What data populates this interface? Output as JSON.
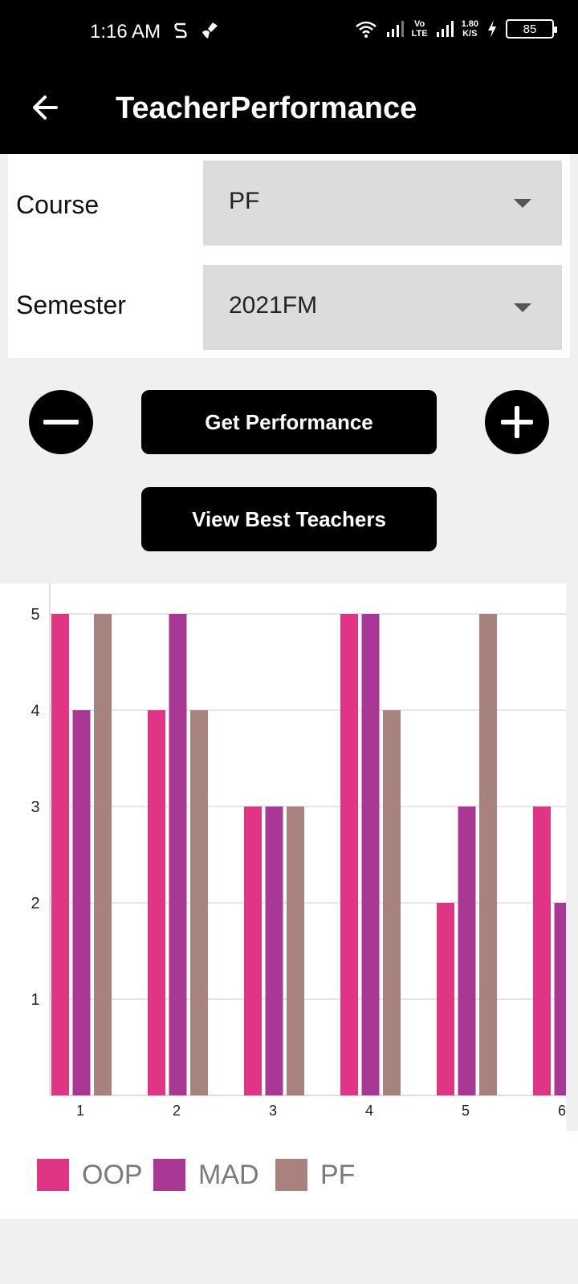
{
  "status_bar": {
    "time": "1:16 AM",
    "net_speed_value": "1.80",
    "net_speed_unit": "K/S",
    "lte_top": "Vo",
    "lte_bottom": "LTE",
    "battery": "85"
  },
  "app_bar": {
    "title": "TeacherPerformance"
  },
  "form": {
    "course_label": "Course",
    "course_value": "PF",
    "semester_label": "Semester",
    "semester_value": "2021FM"
  },
  "buttons": {
    "get_performance": "Get Performance",
    "view_best_teachers": "View Best Teachers"
  },
  "colors": {
    "OOP": "#e03585",
    "MAD": "#a83893",
    "PF": "#a8827c"
  },
  "chart_data": {
    "type": "bar",
    "categories": [
      "1",
      "2",
      "3",
      "4",
      "5",
      "6"
    ],
    "series": [
      {
        "name": "OOP",
        "values": [
          5,
          4,
          3,
          5,
          2,
          3
        ]
      },
      {
        "name": "MAD",
        "values": [
          4,
          5,
          3,
          5,
          3,
          2
        ]
      },
      {
        "name": "PF",
        "values": [
          5,
          4,
          3,
          4,
          5,
          null
        ]
      }
    ],
    "y_ticks": [
      "1",
      "2",
      "3",
      "4",
      "5"
    ],
    "ylim": [
      0,
      5
    ],
    "grid": true,
    "legend_position": "bottom-left"
  }
}
